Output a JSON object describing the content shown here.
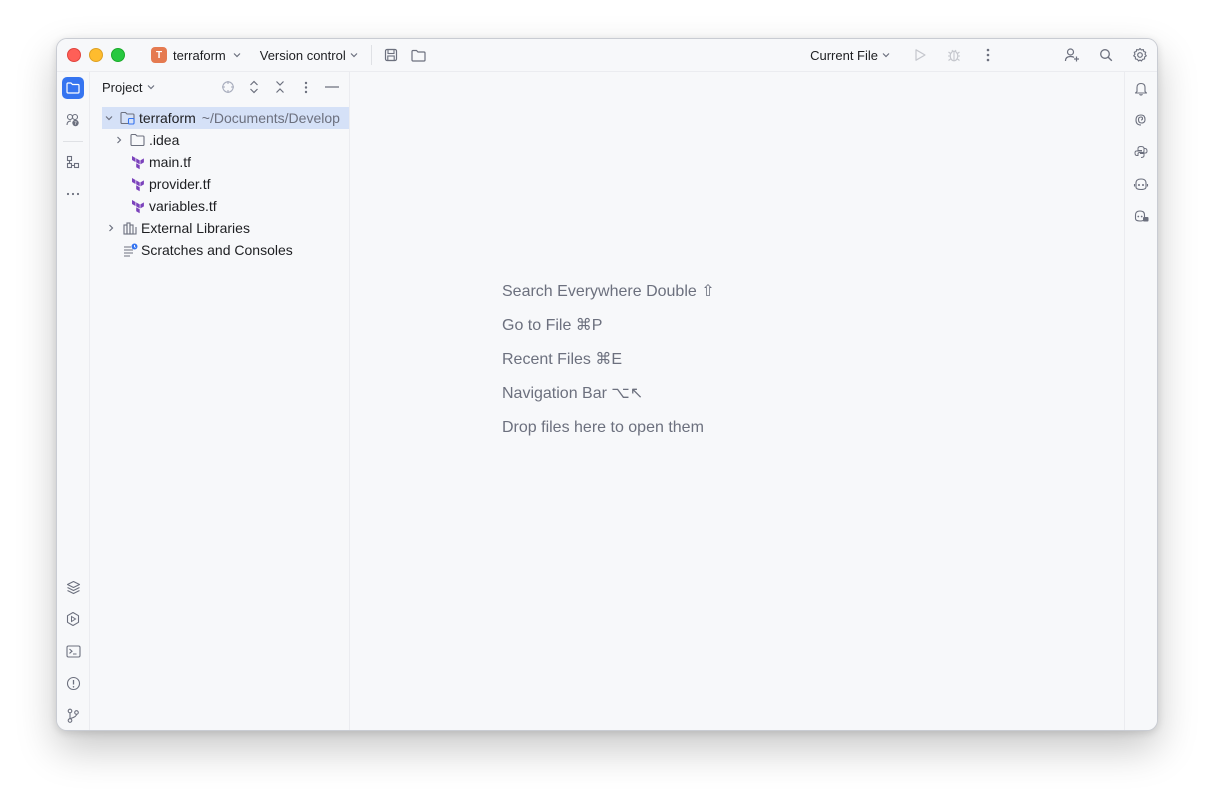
{
  "titlebar": {
    "project_badge": "T",
    "project_name": "terraform",
    "vcs_label": "Version control",
    "run_config": "Current File"
  },
  "project_panel": {
    "title": "Project",
    "tree": [
      {
        "label": "terraform",
        "hint": "~/Documents/Develop",
        "kind": "module-folder",
        "expanded": true,
        "selected": true
      },
      {
        "label": ".idea",
        "kind": "folder",
        "expanded": false
      },
      {
        "label": "main.tf",
        "kind": "terraform-file"
      },
      {
        "label": "provider.tf",
        "kind": "terraform-file"
      },
      {
        "label": "variables.tf",
        "kind": "terraform-file"
      },
      {
        "label": "External Libraries",
        "kind": "libraries",
        "expanded": false
      },
      {
        "label": "Scratches and Consoles",
        "kind": "scratches"
      }
    ]
  },
  "editor": {
    "hints": [
      "Search Everywhere Double ⇧",
      "Go to File ⌘P",
      "Recent Files ⌘E",
      "Navigation Bar ⌥↖",
      "Drop files here to open them"
    ]
  },
  "colors": {
    "accent": "#3574f0",
    "terraform_purple": "#7b42bc",
    "selection": "#d5e1f7",
    "hint_text": "#6c707e"
  }
}
